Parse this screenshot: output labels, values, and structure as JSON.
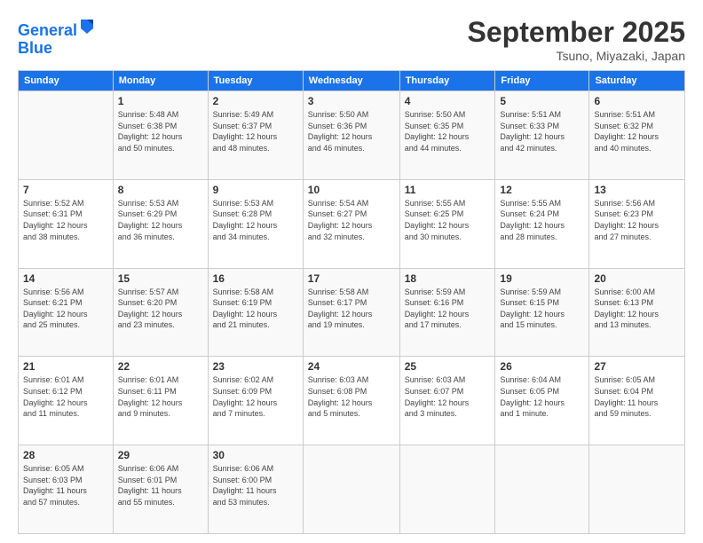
{
  "header": {
    "logo_line1": "General",
    "logo_line2": "Blue",
    "main_title": "September 2025",
    "subtitle": "Tsuno, Miyazaki, Japan"
  },
  "days_of_week": [
    "Sunday",
    "Monday",
    "Tuesday",
    "Wednesday",
    "Thursday",
    "Friday",
    "Saturday"
  ],
  "weeks": [
    [
      {
        "day": "",
        "info": ""
      },
      {
        "day": "1",
        "info": "Sunrise: 5:48 AM\nSunset: 6:38 PM\nDaylight: 12 hours\nand 50 minutes."
      },
      {
        "day": "2",
        "info": "Sunrise: 5:49 AM\nSunset: 6:37 PM\nDaylight: 12 hours\nand 48 minutes."
      },
      {
        "day": "3",
        "info": "Sunrise: 5:50 AM\nSunset: 6:36 PM\nDaylight: 12 hours\nand 46 minutes."
      },
      {
        "day": "4",
        "info": "Sunrise: 5:50 AM\nSunset: 6:35 PM\nDaylight: 12 hours\nand 44 minutes."
      },
      {
        "day": "5",
        "info": "Sunrise: 5:51 AM\nSunset: 6:33 PM\nDaylight: 12 hours\nand 42 minutes."
      },
      {
        "day": "6",
        "info": "Sunrise: 5:51 AM\nSunset: 6:32 PM\nDaylight: 12 hours\nand 40 minutes."
      }
    ],
    [
      {
        "day": "7",
        "info": "Sunrise: 5:52 AM\nSunset: 6:31 PM\nDaylight: 12 hours\nand 38 minutes."
      },
      {
        "day": "8",
        "info": "Sunrise: 5:53 AM\nSunset: 6:29 PM\nDaylight: 12 hours\nand 36 minutes."
      },
      {
        "day": "9",
        "info": "Sunrise: 5:53 AM\nSunset: 6:28 PM\nDaylight: 12 hours\nand 34 minutes."
      },
      {
        "day": "10",
        "info": "Sunrise: 5:54 AM\nSunset: 6:27 PM\nDaylight: 12 hours\nand 32 minutes."
      },
      {
        "day": "11",
        "info": "Sunrise: 5:55 AM\nSunset: 6:25 PM\nDaylight: 12 hours\nand 30 minutes."
      },
      {
        "day": "12",
        "info": "Sunrise: 5:55 AM\nSunset: 6:24 PM\nDaylight: 12 hours\nand 28 minutes."
      },
      {
        "day": "13",
        "info": "Sunrise: 5:56 AM\nSunset: 6:23 PM\nDaylight: 12 hours\nand 27 minutes."
      }
    ],
    [
      {
        "day": "14",
        "info": "Sunrise: 5:56 AM\nSunset: 6:21 PM\nDaylight: 12 hours\nand 25 minutes."
      },
      {
        "day": "15",
        "info": "Sunrise: 5:57 AM\nSunset: 6:20 PM\nDaylight: 12 hours\nand 23 minutes."
      },
      {
        "day": "16",
        "info": "Sunrise: 5:58 AM\nSunset: 6:19 PM\nDaylight: 12 hours\nand 21 minutes."
      },
      {
        "day": "17",
        "info": "Sunrise: 5:58 AM\nSunset: 6:17 PM\nDaylight: 12 hours\nand 19 minutes."
      },
      {
        "day": "18",
        "info": "Sunrise: 5:59 AM\nSunset: 6:16 PM\nDaylight: 12 hours\nand 17 minutes."
      },
      {
        "day": "19",
        "info": "Sunrise: 5:59 AM\nSunset: 6:15 PM\nDaylight: 12 hours\nand 15 minutes."
      },
      {
        "day": "20",
        "info": "Sunrise: 6:00 AM\nSunset: 6:13 PM\nDaylight: 12 hours\nand 13 minutes."
      }
    ],
    [
      {
        "day": "21",
        "info": "Sunrise: 6:01 AM\nSunset: 6:12 PM\nDaylight: 12 hours\nand 11 minutes."
      },
      {
        "day": "22",
        "info": "Sunrise: 6:01 AM\nSunset: 6:11 PM\nDaylight: 12 hours\nand 9 minutes."
      },
      {
        "day": "23",
        "info": "Sunrise: 6:02 AM\nSunset: 6:09 PM\nDaylight: 12 hours\nand 7 minutes."
      },
      {
        "day": "24",
        "info": "Sunrise: 6:03 AM\nSunset: 6:08 PM\nDaylight: 12 hours\nand 5 minutes."
      },
      {
        "day": "25",
        "info": "Sunrise: 6:03 AM\nSunset: 6:07 PM\nDaylight: 12 hours\nand 3 minutes."
      },
      {
        "day": "26",
        "info": "Sunrise: 6:04 AM\nSunset: 6:05 PM\nDaylight: 12 hours\nand 1 minute."
      },
      {
        "day": "27",
        "info": "Sunrise: 6:05 AM\nSunset: 6:04 PM\nDaylight: 11 hours\nand 59 minutes."
      }
    ],
    [
      {
        "day": "28",
        "info": "Sunrise: 6:05 AM\nSunset: 6:03 PM\nDaylight: 11 hours\nand 57 minutes."
      },
      {
        "day": "29",
        "info": "Sunrise: 6:06 AM\nSunset: 6:01 PM\nDaylight: 11 hours\nand 55 minutes."
      },
      {
        "day": "30",
        "info": "Sunrise: 6:06 AM\nSunset: 6:00 PM\nDaylight: 11 hours\nand 53 minutes."
      },
      {
        "day": "",
        "info": ""
      },
      {
        "day": "",
        "info": ""
      },
      {
        "day": "",
        "info": ""
      },
      {
        "day": "",
        "info": ""
      }
    ]
  ]
}
